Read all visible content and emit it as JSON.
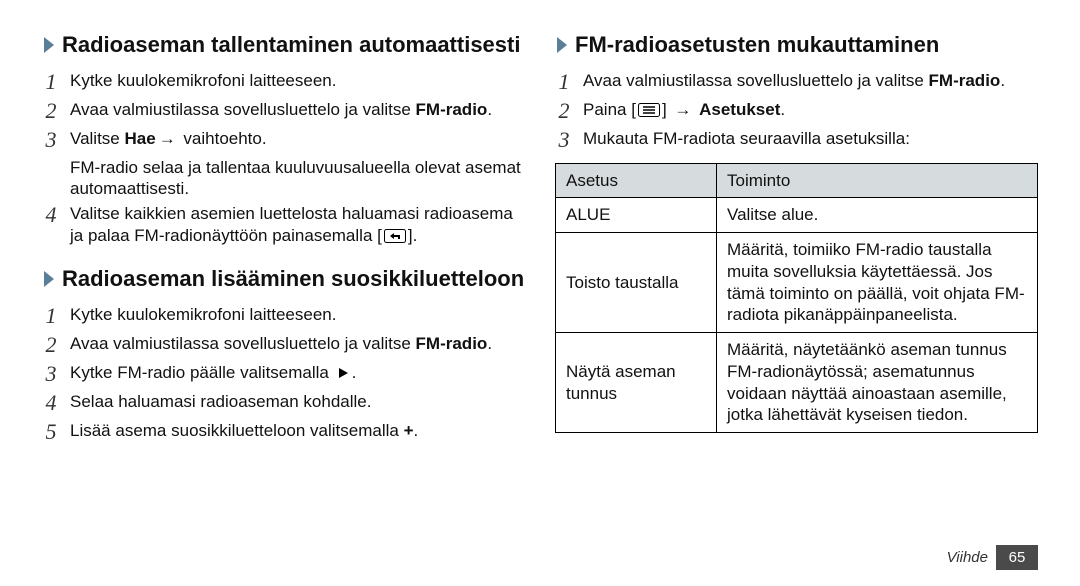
{
  "left": {
    "section1": {
      "title": "Radioaseman tallentaminen automaattisesti",
      "steps": [
        {
          "num": "1",
          "text": "Kytke kuulokemikrofoni laitteeseen."
        },
        {
          "num": "2",
          "prefix": "Avaa valmiustilassa sovellusluettelo ja valitse ",
          "bold": "FM-radio",
          "suffix": "."
        },
        {
          "num": "3",
          "prefix": "Valitse ",
          "bold": "Hae",
          "arrow": "→",
          "tail": " vaihtoehto."
        },
        {
          "num": "4",
          "text": "Valitse kaikkien asemien luettelosta haluamasi radioasema ja palaa FM-radionäyttöön painasemalla ["
        }
      ],
      "subAfter3": "FM-radio selaa ja tallentaa kuuluvuusalueella olevat asemat automaattisesti.",
      "step4tail": "]."
    },
    "section2": {
      "title": "Radioaseman lisääminen suosikkiluetteloon",
      "steps": [
        {
          "num": "1",
          "text": "Kytke kuulokemikrofoni laitteeseen."
        },
        {
          "num": "2",
          "prefix": "Avaa valmiustilassa sovellusluettelo ja valitse ",
          "bold": "FM-radio",
          "suffix": "."
        },
        {
          "num": "3",
          "text": "Kytke FM-radio päälle valitsemalla "
        },
        {
          "num": "4",
          "text": "Selaa haluamasi radioaseman kohdalle."
        },
        {
          "num": "5",
          "prefix": "Lisää asema suosikkiluetteloon valitsemalla ",
          "bold": "+",
          "suffix": "."
        }
      ],
      "step3tail": "."
    }
  },
  "right": {
    "section3": {
      "title": "FM-radioasetusten mukauttaminen",
      "steps": [
        {
          "num": "1",
          "prefix": "Avaa valmiustilassa sovellusluettelo ja valitse ",
          "bold": "FM-radio",
          "suffix": "."
        },
        {
          "num": "2",
          "prefix": "Paina [",
          "iconAfter": true,
          "arrow": "→",
          "bold2": "Asetukset",
          "suffix2": "."
        },
        {
          "num": "3",
          "text": "Mukauta FM-radiota seuraavilla asetuksilla:"
        }
      ],
      "step2mid": "] "
    },
    "table": {
      "headers": [
        "Asetus",
        "Toiminto"
      ],
      "rows": [
        {
          "setting": "ALUE",
          "desc": "Valitse alue."
        },
        {
          "setting": "Toisto taustalla",
          "desc": "Määritä, toimiiko FM-radio taustalla muita sovelluksia käytettäessä. Jos tämä toiminto on päällä, voit ohjata FM-radiota pikanäppäinpaneelista."
        },
        {
          "setting": "Näytä aseman tunnus",
          "desc": "Määritä, näytetäänkö aseman tunnus FM-radionäytössä; asematunnus voidaan näyttää ainoastaan asemille, jotka lähettävät kyseisen tiedon."
        }
      ]
    }
  },
  "footer": {
    "label": "Viihde",
    "page": "65"
  }
}
